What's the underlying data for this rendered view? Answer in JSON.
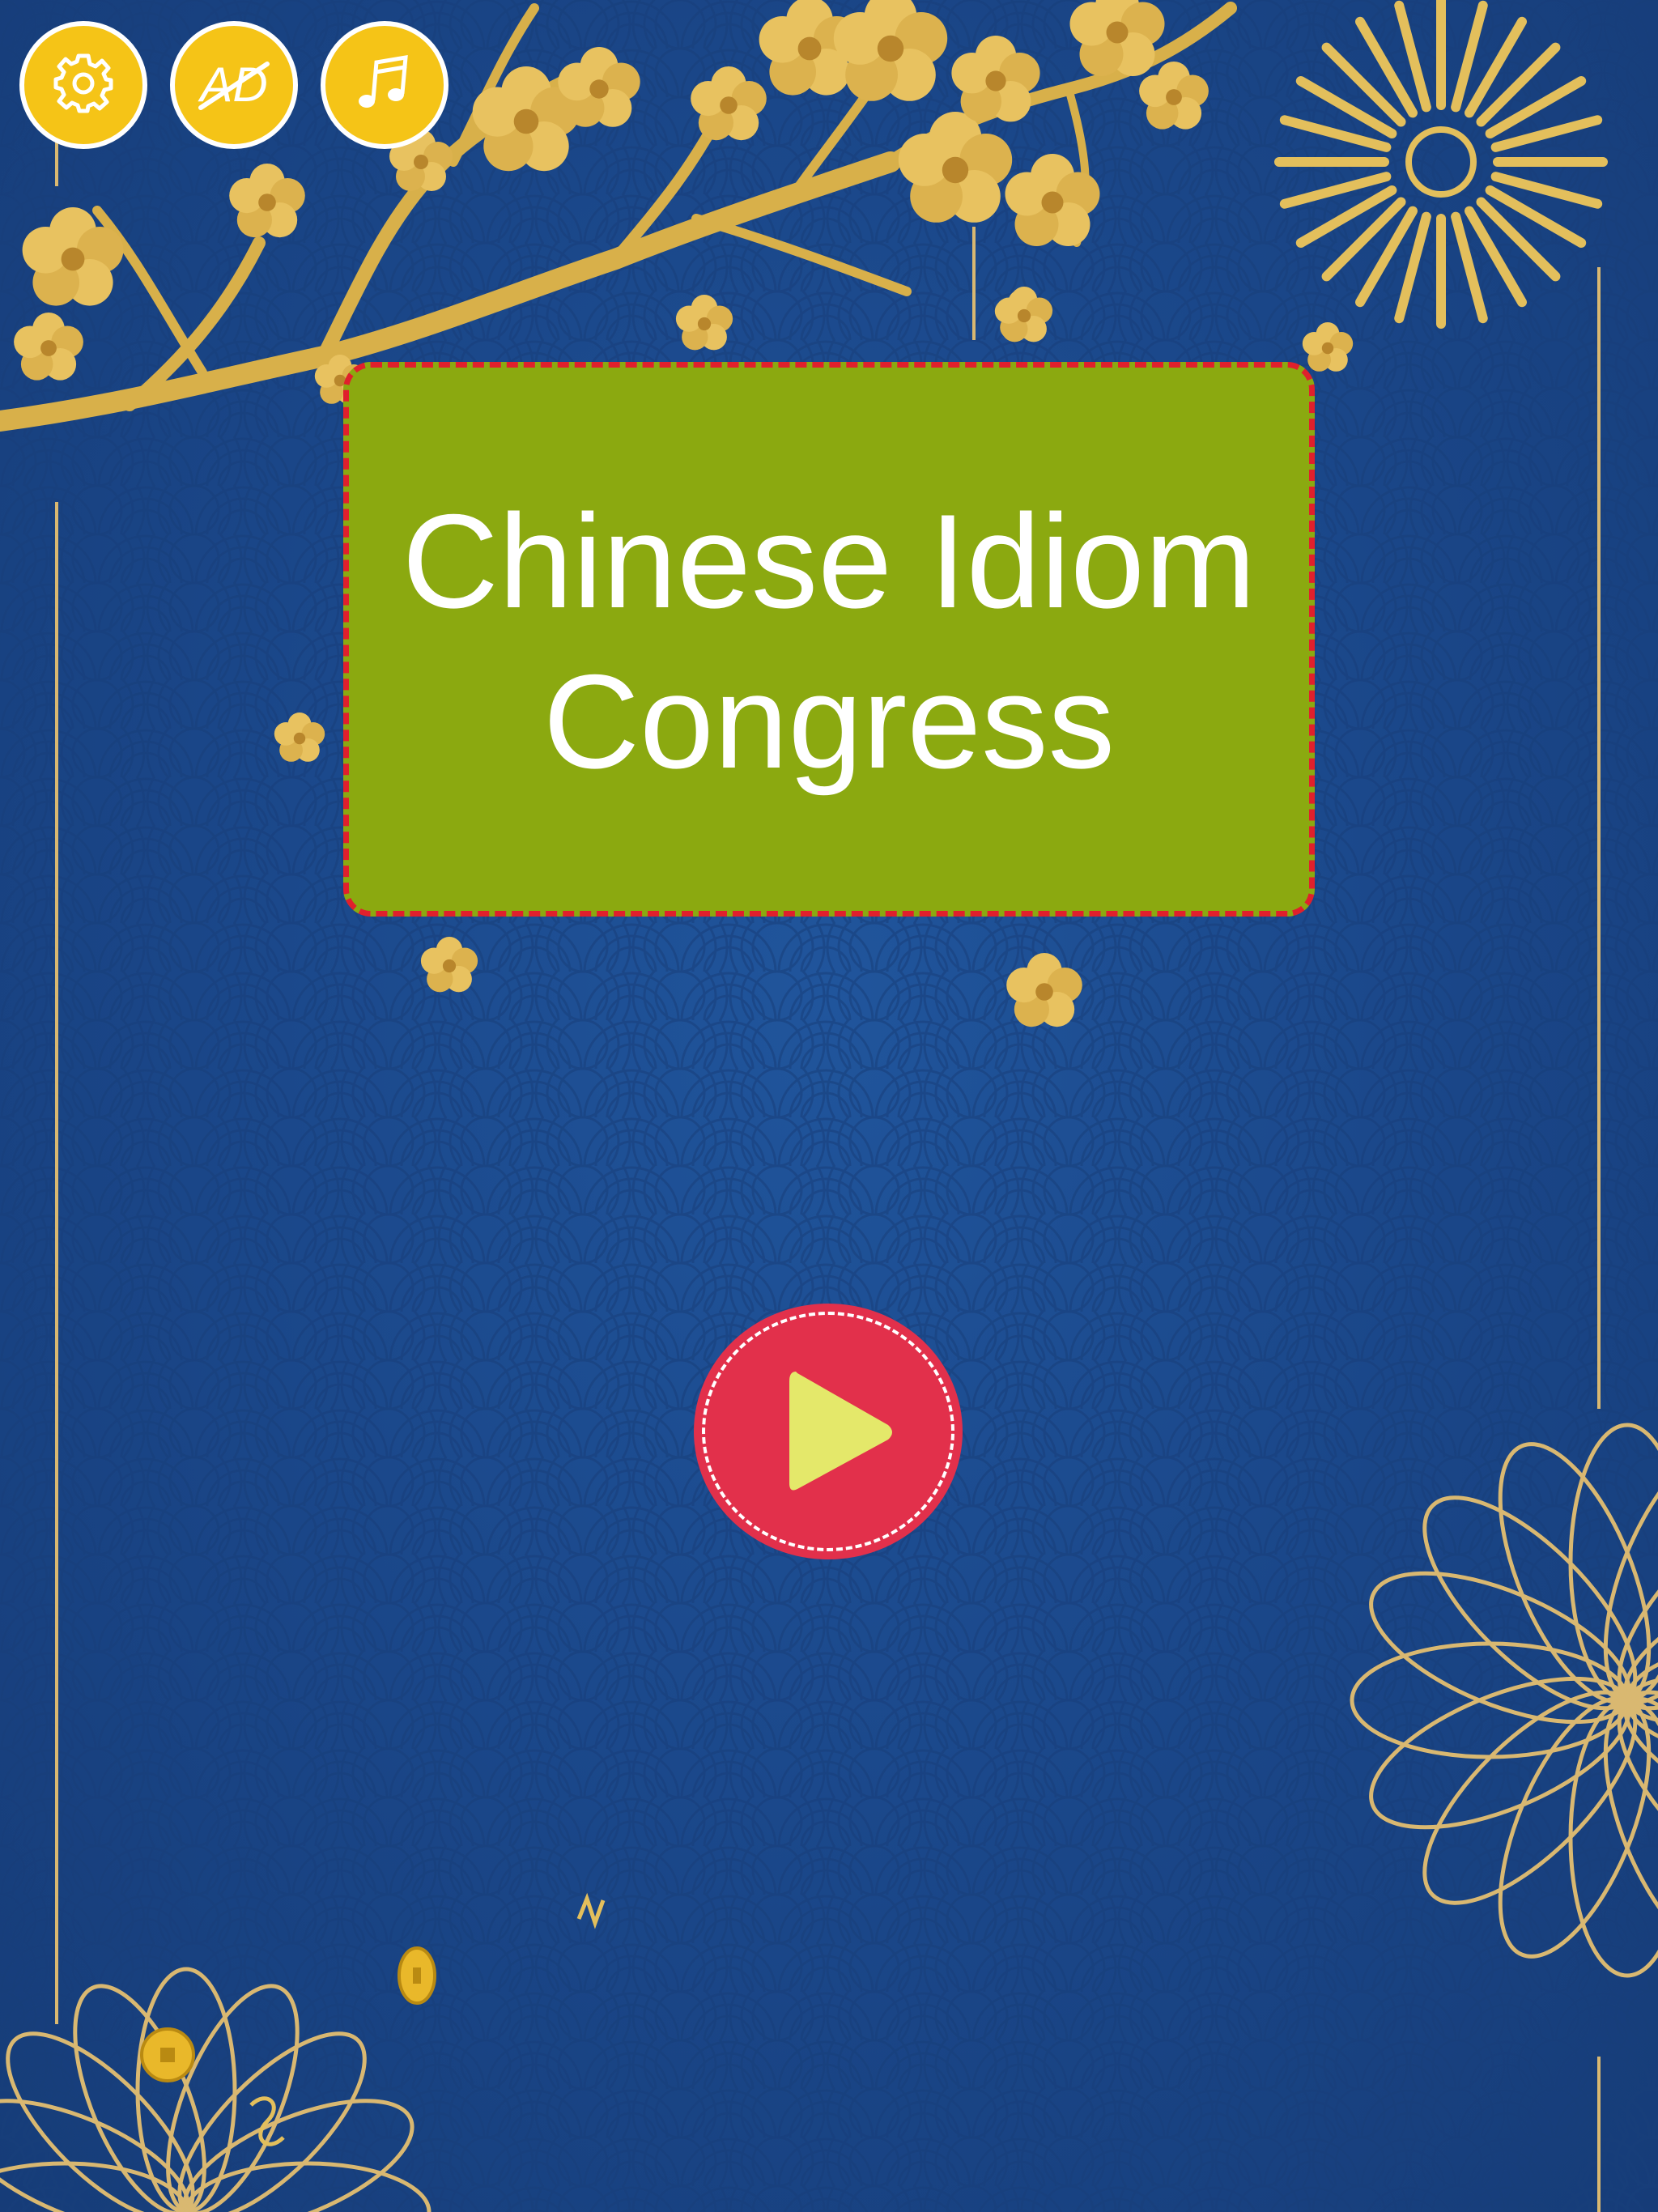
{
  "game": {
    "title": "Chinese Idiom Congress"
  },
  "top_bar": {
    "settings_icon": "gear-icon",
    "no_ads_icon": "ad-crossed-icon",
    "no_ads_label": "AD",
    "music_icon": "music-note-icon"
  },
  "play": {
    "icon": "play-icon"
  },
  "colors": {
    "background": "#1a4688",
    "gold": "#e9c46a",
    "button_yellow": "#f5c417",
    "title_card": "#8ba910",
    "title_border": "#e0202c",
    "play_red": "#e2304b",
    "play_triangle": "#e4e86a"
  }
}
